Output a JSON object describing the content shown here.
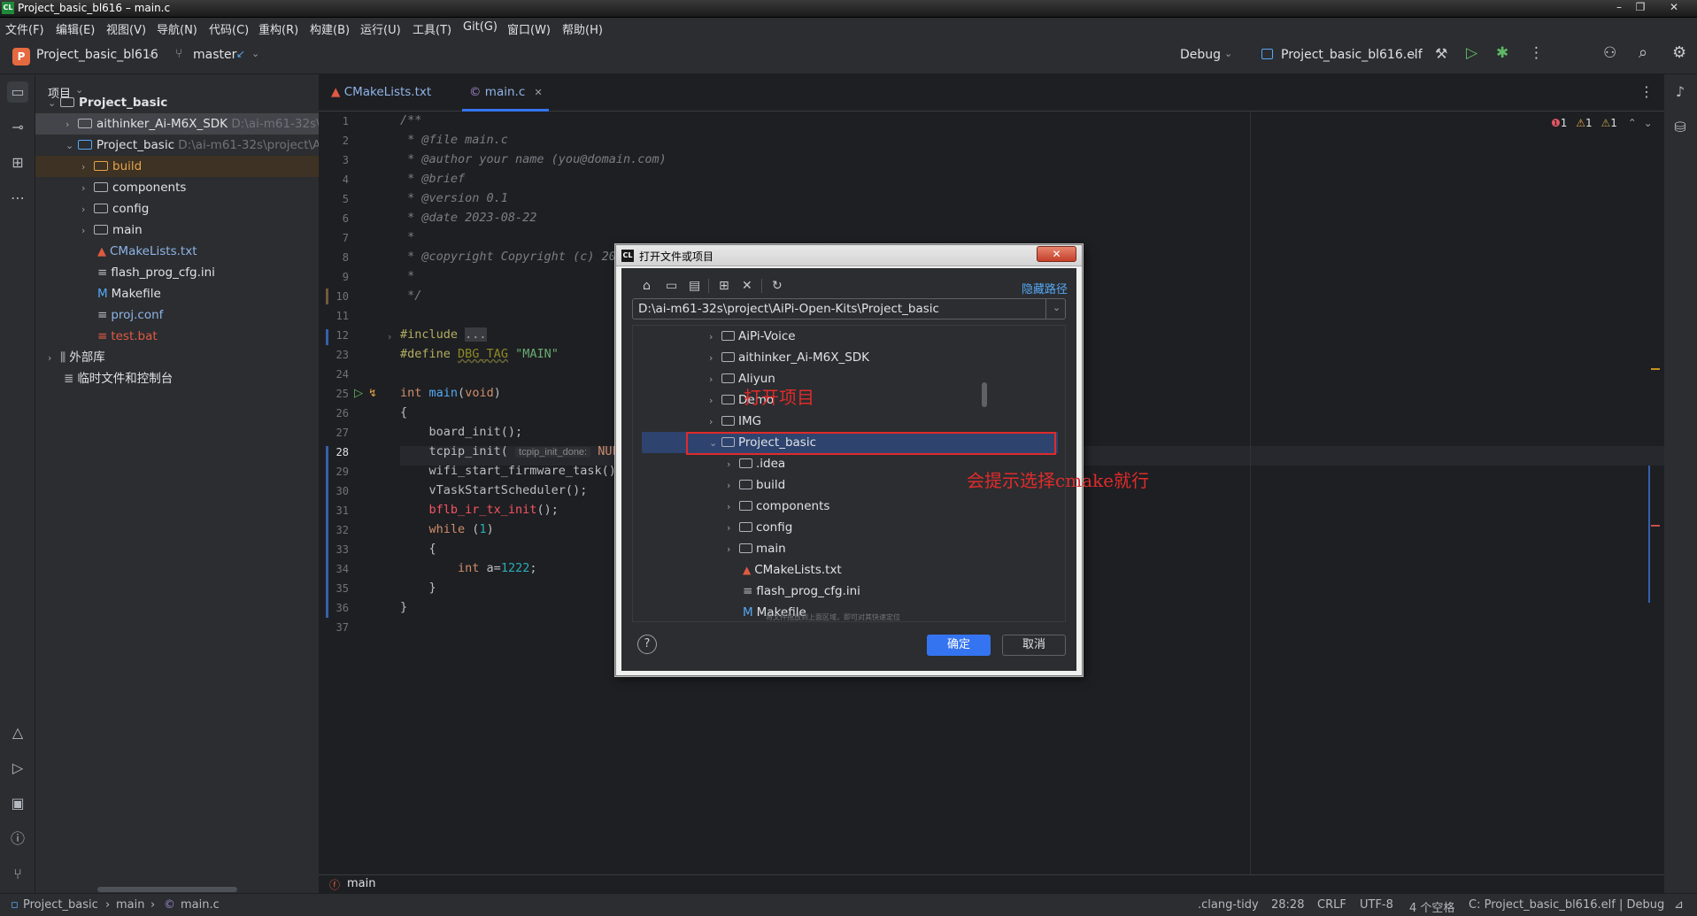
{
  "window": {
    "title": "Project_basic_bl616 – main.c",
    "logo": "CL"
  },
  "menu": [
    "文件(F)",
    "编辑(E)",
    "视图(V)",
    "导航(N)",
    "代码(C)",
    "重构(R)",
    "构建(B)",
    "运行(U)",
    "工具(T)",
    "Git(G)",
    "窗口(W)",
    "帮助(H)"
  ],
  "toolbar": {
    "project_initial": "P",
    "project_name": "Project_basic_bl616",
    "branch": "master",
    "config": "Debug",
    "target": "Project_basic_bl616.elf"
  },
  "project_panel": {
    "title": "项目",
    "root": "Project_basic",
    "sdk": {
      "name": "aithinker_Ai-M6X_SDK",
      "path": "D:\\ai-m61-32s\\pr"
    },
    "project": {
      "name": "Project_basic",
      "path": "D:\\ai-m61-32s\\project\\AiP"
    },
    "children": [
      "build",
      "components",
      "config",
      "main",
      "CMakeLists.txt",
      "flash_prog_cfg.ini",
      "Makefile",
      "proj.conf",
      "test.bat"
    ],
    "external_libs": "外部库",
    "scratches": "临时文件和控制台"
  },
  "tabs": [
    {
      "label": "CMakeLists.txt",
      "icon": "cmake-icon"
    },
    {
      "label": "main.c",
      "icon": "c-file-icon",
      "active": true
    }
  ],
  "editor": {
    "line_numbers": [
      "1",
      "2",
      "3",
      "4",
      "5",
      "6",
      "7",
      "8",
      "9",
      "10",
      "11",
      "12",
      "23",
      "24",
      "25",
      "26",
      "27",
      "28",
      "29",
      "30",
      "31",
      "32",
      "33",
      "34",
      "35",
      "36",
      "37"
    ],
    "inspections": {
      "errors": "1",
      "warnings": "1",
      "weak_warnings": "1"
    },
    "hint_tcpip": "tcpip_init_done:",
    "crumb": "main"
  },
  "dialog": {
    "title": "打开文件或项目",
    "hide_path": "隐藏路径",
    "path": "D:\\ai-m61-32s\\project\\AiPi-Open-Kits\\Project_basic",
    "items": [
      "AiPi-Voice",
      "aithinker_Ai-M6X_SDK",
      "Aliyun",
      "Demo",
      "IMG",
      "Project_basic"
    ],
    "sub_items": [
      ".idea",
      "build",
      "components",
      "config",
      "main",
      "CMakeLists.txt",
      "flash_prog_cfg.ini",
      "Makefile"
    ],
    "hint": "将文件拖放到上面区域，即可对其快速定位",
    "ok": "确定",
    "cancel": "取消",
    "help": "?",
    "annotation_open": "打开项目",
    "annotation_cmake": "会提示选择cmake就行"
  },
  "status": {
    "crumbs": [
      "Project_basic",
      "main",
      "main.c"
    ],
    "clang": ".clang-tidy",
    "position": "28:28",
    "line_sep": "CRLF",
    "encoding": "UTF-8",
    "indent": "4 个空格",
    "context": "C: Project_basic_bl616.elf | Debug"
  }
}
